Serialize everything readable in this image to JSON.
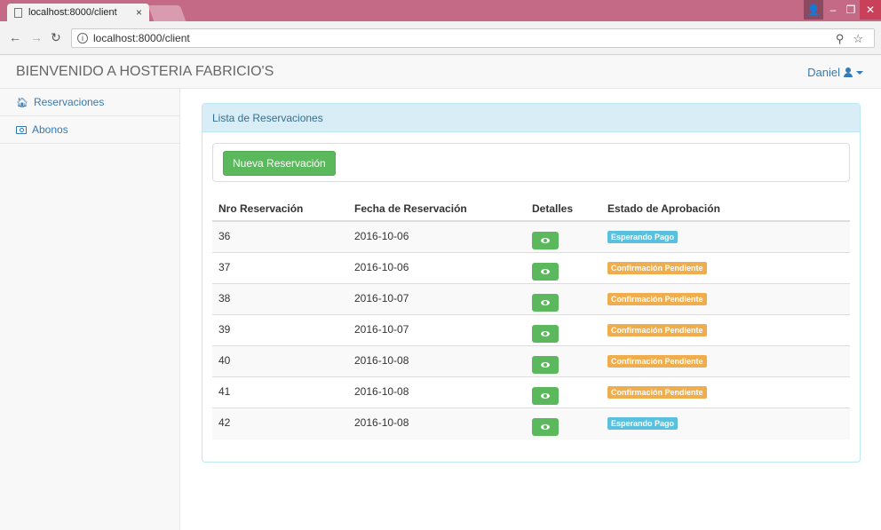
{
  "browser": {
    "tab_title": "localhost:8000/client",
    "tab_close": "×",
    "url": "localhost:8000/client",
    "info_icon": "i"
  },
  "app": {
    "brand": "BIENVENIDO A HOSTERIA FABRICIO'S",
    "user_name": "Daniel"
  },
  "sidebar": {
    "items": [
      {
        "label": "Reservaciones",
        "icon": "home-icon"
      },
      {
        "label": "Abonos",
        "icon": "money-icon"
      }
    ]
  },
  "panel": {
    "heading": "Lista de Reservaciones",
    "new_button": "Nueva Reservación"
  },
  "table": {
    "headers": [
      "Nro Reservación",
      "Fecha de Reservación",
      "Detalles",
      "Estado de Aprobación"
    ],
    "rows": [
      {
        "nro": "36",
        "fecha": "2016-10-06",
        "estado": "Esperando Pago",
        "status": "info"
      },
      {
        "nro": "37",
        "fecha": "2016-10-06",
        "estado": "Confirmación Pendiente",
        "status": "warning"
      },
      {
        "nro": "38",
        "fecha": "2016-10-07",
        "estado": "Confirmación Pendiente",
        "status": "warning"
      },
      {
        "nro": "39",
        "fecha": "2016-10-07",
        "estado": "Confirmación Pendiente",
        "status": "warning"
      },
      {
        "nro": "40",
        "fecha": "2016-10-08",
        "estado": "Confirmación Pendiente",
        "status": "warning"
      },
      {
        "nro": "41",
        "fecha": "2016-10-08",
        "estado": "Confirmación Pendiente",
        "status": "warning"
      },
      {
        "nro": "42",
        "fecha": "2016-10-08",
        "estado": "Esperando Pago",
        "status": "info"
      }
    ]
  },
  "colors": {
    "info": "#5bc0de",
    "warning": "#f0ad4e",
    "success": "#5cb85c",
    "link": "#337ab7",
    "tabbar": "#c46a86"
  }
}
